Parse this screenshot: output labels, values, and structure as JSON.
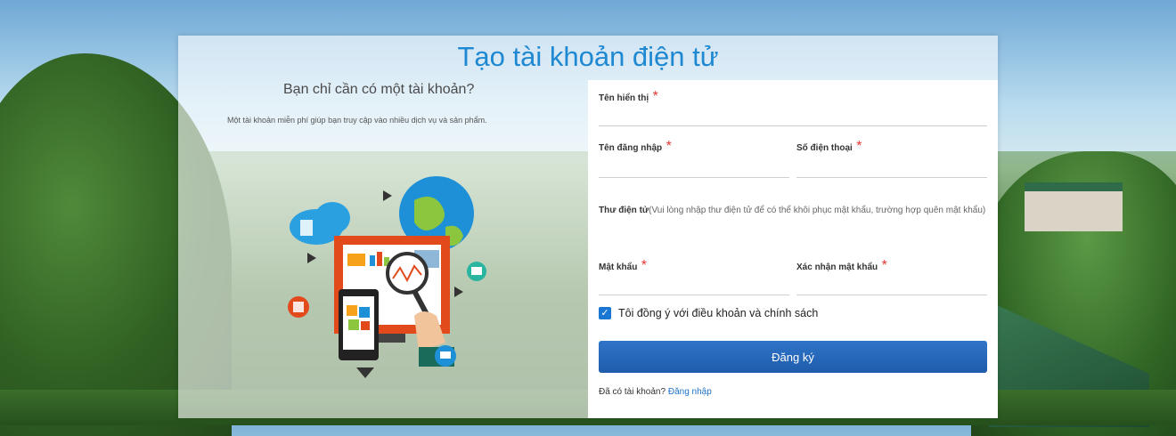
{
  "page": {
    "title": "Tạo tài khoản điện tử"
  },
  "intro": {
    "subtitle": "Bạn chỉ cần có một tài khoản?",
    "description": "Một tài khoản miễn phí giúp bạn truy cập vào nhiều dịch vụ và sản phẩm."
  },
  "form": {
    "display_name_label": "Tên hiển thị",
    "username_label": "Tên đăng nhập",
    "phone_label": "Số điện thoại",
    "email_label": "Thư điện tử",
    "email_hint": "(Vui lòng nhập thư điện tử để có thể khôi phục mật khẩu, trường hợp quên mật khẩu)",
    "password_label": "Mật khẩu",
    "confirm_label": "Xác nhận mật khẩu",
    "required_mark": "*",
    "agree_label": "Tôi đồng ý với điều khoản và chính sách",
    "agree_checked": true,
    "submit_label": "Đăng ký",
    "have_account_text": "Đã có tài khoản?",
    "login_link": "Đăng nhập"
  },
  "colors": {
    "title": "#1e88d2",
    "button": "#1f5cab",
    "required": "#e53935",
    "link": "#1e73c8"
  },
  "icons": {
    "illustration": "analytics-devices-illustration",
    "checkbox": "checkmark-icon"
  }
}
